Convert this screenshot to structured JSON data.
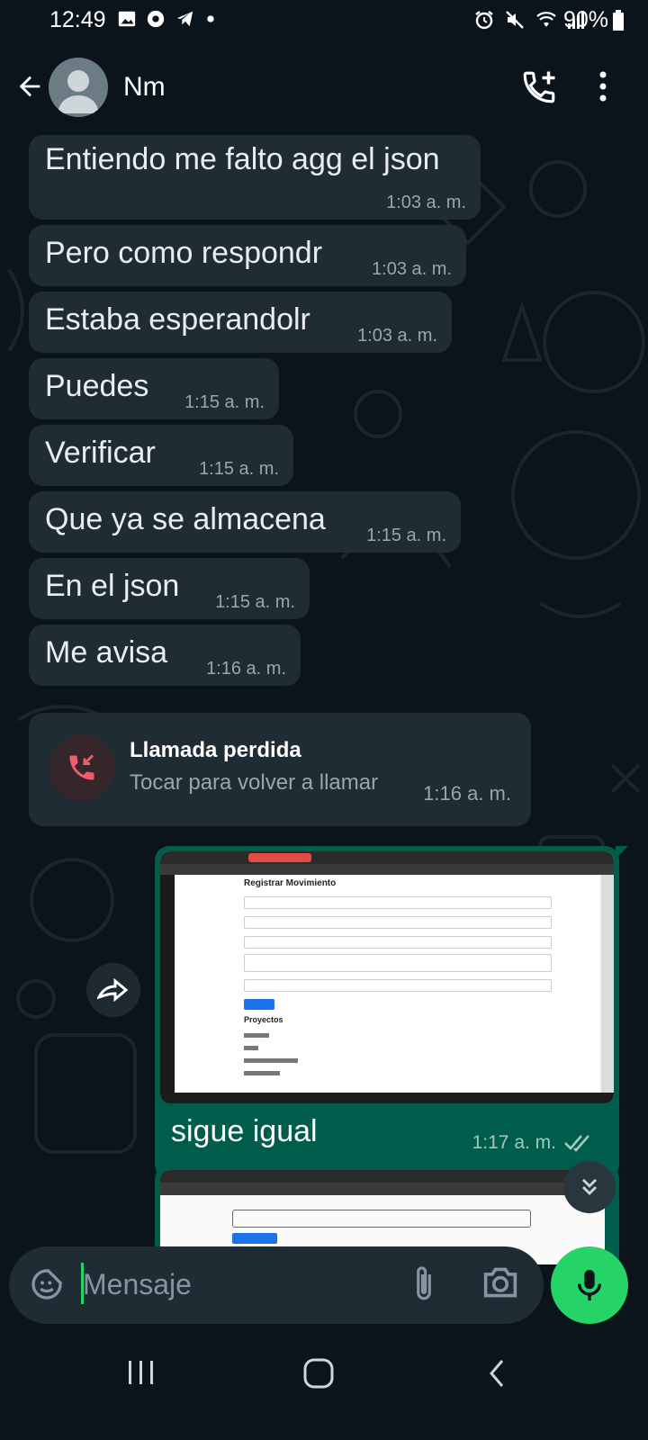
{
  "status_bar": {
    "time": "12:49",
    "battery": "90%",
    "left_icons": [
      "gallery-icon",
      "chrome-icon",
      "telegram-icon",
      "dot-icon"
    ],
    "right_icons": [
      "alarm-icon",
      "mute-icon",
      "wifi-icon",
      "signal-icon"
    ]
  },
  "header": {
    "contact_name": "Nm",
    "icons": [
      "back-arrow-icon",
      "avatar",
      "add-call-icon",
      "more-vert-icon"
    ]
  },
  "messages": [
    {
      "text": "Entiendo me falto agg el json",
      "time": "1:03 a. m."
    },
    {
      "text": "Pero como respondr",
      "time": "1:03 a. m."
    },
    {
      "text": "Estaba esperandolr",
      "time": "1:03 a. m."
    },
    {
      "text": "Puedes",
      "time": "1:15 a. m."
    },
    {
      "text": "Verificar",
      "time": "1:15 a. m."
    },
    {
      "text": "Que ya se almacena",
      "time": "1:15 a. m."
    },
    {
      "text": "En el json",
      "time": "1:15 a. m."
    },
    {
      "text": "Me avisa",
      "time": "1:16 a. m."
    }
  ],
  "missed_call": {
    "title": "Llamada perdida",
    "subtitle": "Tocar para volver a llamar",
    "time": "1:16 a. m."
  },
  "outgoing": {
    "caption": "sigue igual",
    "time": "1:17 a. m.",
    "status": "read-double-check",
    "screenshot": {
      "heading": "Registrar Movimiento",
      "section": "Proyectos"
    }
  },
  "composer": {
    "placeholder": "Mensaje"
  },
  "colors": {
    "background": "#0b141a",
    "incoming_bubble": "#202c33",
    "outgoing_bubble": "#005c4b",
    "accent": "#25d366",
    "missed_red": "#f15c6d"
  }
}
